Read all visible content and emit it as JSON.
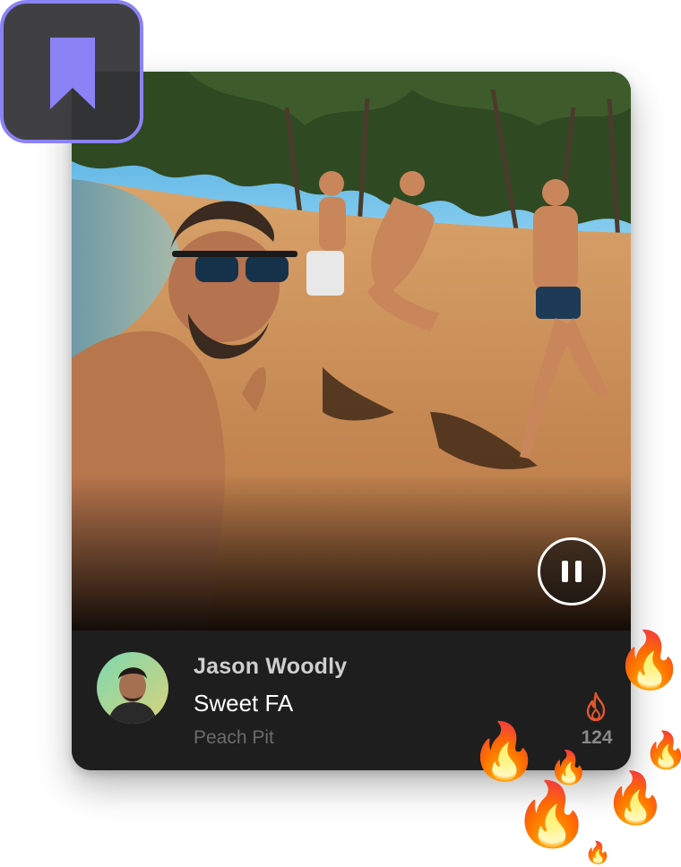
{
  "player": {
    "user_name": "Jason Woodly",
    "track_title": "Sweet FA",
    "artist": "Peach Pit",
    "fire_count": "124"
  },
  "icons": {
    "bookmark": "bookmark-icon",
    "pause": "pause-icon",
    "fire": "fire-icon"
  },
  "decorations": {
    "fire_emoji": "🔥"
  },
  "colors": {
    "card_background": "#1e1e1e",
    "bookmark_accent": "#8b82f6",
    "fire_accent": "#e4572e"
  }
}
